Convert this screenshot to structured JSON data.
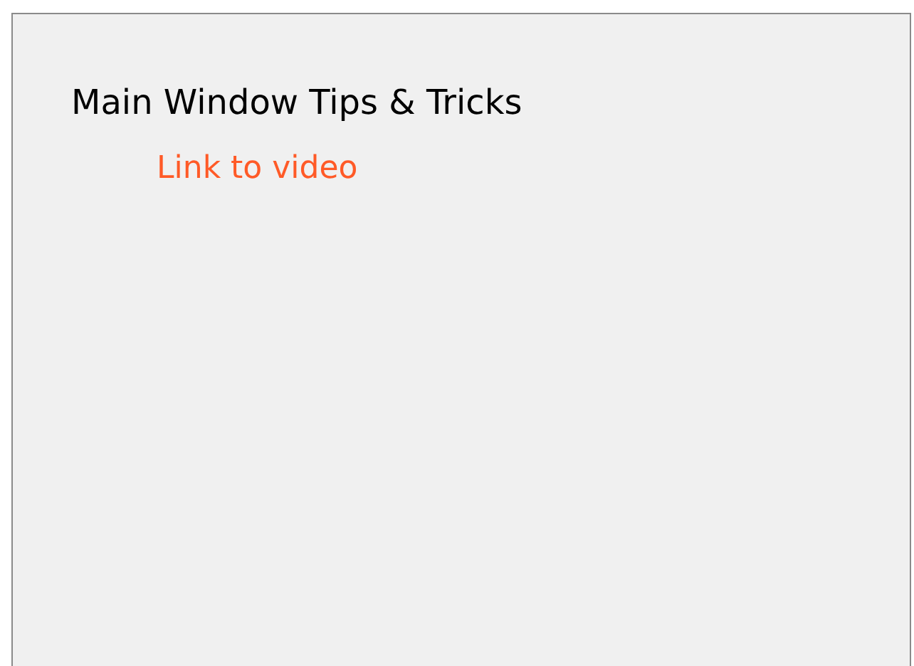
{
  "panel": {
    "title": "Main Window Tips & Tricks",
    "links": [
      {
        "label": "Link to video"
      }
    ]
  }
}
